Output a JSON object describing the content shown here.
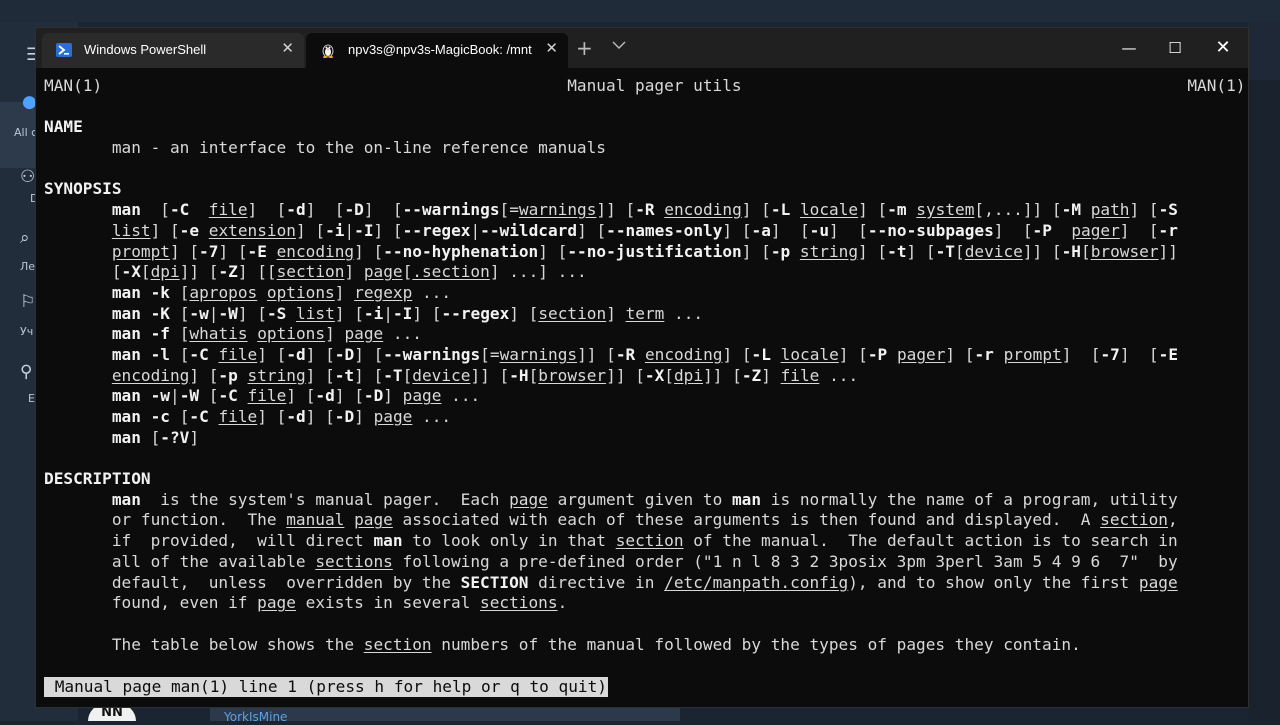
{
  "background_app": {
    "rail_labels": [
      "All c",
      "D",
      "Ле",
      "Уч",
      "E"
    ],
    "bottom_logo_text": "NN",
    "bottom_link": "YorkIsMine"
  },
  "window": {
    "tabs": [
      {
        "title": "Windows PowerShell",
        "icon": "powershell-icon",
        "active": false
      },
      {
        "title": "npv3s@npv3s-MagicBook: /mnt",
        "icon": "linux-tux-icon",
        "active": true
      }
    ],
    "new_tab_glyph": "+",
    "dropdown_glyph": "⌄",
    "controls": {
      "minimize": "—",
      "maximize": "☐",
      "close": "✕"
    }
  },
  "terminal": {
    "lines": [
      [
        {
          "t": "MAN(1)                                                Manual pager utils                                              MAN(1)"
        }
      ],
      [
        {
          "t": ""
        }
      ],
      [
        {
          "t": "NAME",
          "s": "b"
        }
      ],
      [
        {
          "t": "       man - an interface to the on-line reference manuals"
        }
      ],
      [
        {
          "t": ""
        }
      ],
      [
        {
          "t": "SYNOPSIS",
          "s": "b"
        }
      ],
      [
        {
          "t": "       "
        },
        {
          "t": "man",
          "s": "b"
        },
        {
          "t": "  ["
        },
        {
          "t": "-C",
          "s": "b"
        },
        {
          "t": "  "
        },
        {
          "t": "file",
          "s": "u"
        },
        {
          "t": "]  ["
        },
        {
          "t": "-d",
          "s": "b"
        },
        {
          "t": "]  ["
        },
        {
          "t": "-D",
          "s": "b"
        },
        {
          "t": "]  ["
        },
        {
          "t": "--warnings",
          "s": "b"
        },
        {
          "t": "[="
        },
        {
          "t": "warnings",
          "s": "u"
        },
        {
          "t": "]] ["
        },
        {
          "t": "-R",
          "s": "b"
        },
        {
          "t": " "
        },
        {
          "t": "encoding",
          "s": "u"
        },
        {
          "t": "] ["
        },
        {
          "t": "-L",
          "s": "b"
        },
        {
          "t": " "
        },
        {
          "t": "locale",
          "s": "u"
        },
        {
          "t": "] ["
        },
        {
          "t": "-m",
          "s": "b"
        },
        {
          "t": " "
        },
        {
          "t": "system",
          "s": "u"
        },
        {
          "t": "[,...]] ["
        },
        {
          "t": "-M",
          "s": "b"
        },
        {
          "t": " "
        },
        {
          "t": "path",
          "s": "u"
        },
        {
          "t": "] ["
        },
        {
          "t": "-S",
          "s": "b"
        }
      ],
      [
        {
          "t": "       "
        },
        {
          "t": "list",
          "s": "u"
        },
        {
          "t": "] ["
        },
        {
          "t": "-e",
          "s": "b"
        },
        {
          "t": " "
        },
        {
          "t": "extension",
          "s": "u"
        },
        {
          "t": "] ["
        },
        {
          "t": "-i",
          "s": "b"
        },
        {
          "t": "|"
        },
        {
          "t": "-I",
          "s": "b"
        },
        {
          "t": "] ["
        },
        {
          "t": "--regex",
          "s": "b"
        },
        {
          "t": "|"
        },
        {
          "t": "--wildcard",
          "s": "b"
        },
        {
          "t": "] ["
        },
        {
          "t": "--names-only",
          "s": "b"
        },
        {
          "t": "] ["
        },
        {
          "t": "-a",
          "s": "b"
        },
        {
          "t": "]  ["
        },
        {
          "t": "-u",
          "s": "b"
        },
        {
          "t": "]  ["
        },
        {
          "t": "--no-subpages",
          "s": "b"
        },
        {
          "t": "]  ["
        },
        {
          "t": "-P",
          "s": "b"
        },
        {
          "t": "  "
        },
        {
          "t": "pager",
          "s": "u"
        },
        {
          "t": "]  ["
        },
        {
          "t": "-r",
          "s": "b"
        }
      ],
      [
        {
          "t": "       "
        },
        {
          "t": "prompt",
          "s": "u"
        },
        {
          "t": "] ["
        },
        {
          "t": "-7",
          "s": "b"
        },
        {
          "t": "] ["
        },
        {
          "t": "-E",
          "s": "b"
        },
        {
          "t": " "
        },
        {
          "t": "encoding",
          "s": "u"
        },
        {
          "t": "] ["
        },
        {
          "t": "--no-hyphenation",
          "s": "b"
        },
        {
          "t": "] ["
        },
        {
          "t": "--no-justification",
          "s": "b"
        },
        {
          "t": "] ["
        },
        {
          "t": "-p",
          "s": "b"
        },
        {
          "t": " "
        },
        {
          "t": "string",
          "s": "u"
        },
        {
          "t": "] ["
        },
        {
          "t": "-t",
          "s": "b"
        },
        {
          "t": "] ["
        },
        {
          "t": "-T",
          "s": "b"
        },
        {
          "t": "["
        },
        {
          "t": "device",
          "s": "u"
        },
        {
          "t": "]] ["
        },
        {
          "t": "-H",
          "s": "b"
        },
        {
          "t": "["
        },
        {
          "t": "browser",
          "s": "u"
        },
        {
          "t": "]]"
        }
      ],
      [
        {
          "t": "       ["
        },
        {
          "t": "-X",
          "s": "b"
        },
        {
          "t": "["
        },
        {
          "t": "dpi",
          "s": "u"
        },
        {
          "t": "]] ["
        },
        {
          "t": "-Z",
          "s": "b"
        },
        {
          "t": "] [["
        },
        {
          "t": "section",
          "s": "u"
        },
        {
          "t": "] "
        },
        {
          "t": "page",
          "s": "u"
        },
        {
          "t": "["
        },
        {
          "t": ".section",
          "s": "u"
        },
        {
          "t": "] ...] ..."
        }
      ],
      [
        {
          "t": "       "
        },
        {
          "t": "man",
          "s": "b"
        },
        {
          "t": " "
        },
        {
          "t": "-k",
          "s": "b"
        },
        {
          "t": " ["
        },
        {
          "t": "apropos",
          "s": "u"
        },
        {
          "t": " "
        },
        {
          "t": "options",
          "s": "u"
        },
        {
          "t": "] "
        },
        {
          "t": "regexp",
          "s": "u"
        },
        {
          "t": " ..."
        }
      ],
      [
        {
          "t": "       "
        },
        {
          "t": "man",
          "s": "b"
        },
        {
          "t": " "
        },
        {
          "t": "-K",
          "s": "b"
        },
        {
          "t": " ["
        },
        {
          "t": "-w",
          "s": "b"
        },
        {
          "t": "|"
        },
        {
          "t": "-W",
          "s": "b"
        },
        {
          "t": "] ["
        },
        {
          "t": "-S",
          "s": "b"
        },
        {
          "t": " "
        },
        {
          "t": "list",
          "s": "u"
        },
        {
          "t": "] ["
        },
        {
          "t": "-i",
          "s": "b"
        },
        {
          "t": "|"
        },
        {
          "t": "-I",
          "s": "b"
        },
        {
          "t": "] ["
        },
        {
          "t": "--regex",
          "s": "b"
        },
        {
          "t": "] ["
        },
        {
          "t": "section",
          "s": "u"
        },
        {
          "t": "] "
        },
        {
          "t": "term",
          "s": "u"
        },
        {
          "t": " ..."
        }
      ],
      [
        {
          "t": "       "
        },
        {
          "t": "man",
          "s": "b"
        },
        {
          "t": " "
        },
        {
          "t": "-f",
          "s": "b"
        },
        {
          "t": " ["
        },
        {
          "t": "whatis",
          "s": "u"
        },
        {
          "t": " "
        },
        {
          "t": "options",
          "s": "u"
        },
        {
          "t": "] "
        },
        {
          "t": "page",
          "s": "u"
        },
        {
          "t": " ..."
        }
      ],
      [
        {
          "t": "       "
        },
        {
          "t": "man",
          "s": "b"
        },
        {
          "t": " "
        },
        {
          "t": "-l",
          "s": "b"
        },
        {
          "t": " ["
        },
        {
          "t": "-C",
          "s": "b"
        },
        {
          "t": " "
        },
        {
          "t": "file",
          "s": "u"
        },
        {
          "t": "] ["
        },
        {
          "t": "-d",
          "s": "b"
        },
        {
          "t": "] ["
        },
        {
          "t": "-D",
          "s": "b"
        },
        {
          "t": "] ["
        },
        {
          "t": "--warnings",
          "s": "b"
        },
        {
          "t": "[="
        },
        {
          "t": "warnings",
          "s": "u"
        },
        {
          "t": "]] ["
        },
        {
          "t": "-R",
          "s": "b"
        },
        {
          "t": " "
        },
        {
          "t": "encoding",
          "s": "u"
        },
        {
          "t": "] ["
        },
        {
          "t": "-L",
          "s": "b"
        },
        {
          "t": " "
        },
        {
          "t": "locale",
          "s": "u"
        },
        {
          "t": "] ["
        },
        {
          "t": "-P",
          "s": "b"
        },
        {
          "t": " "
        },
        {
          "t": "pager",
          "s": "u"
        },
        {
          "t": "] ["
        },
        {
          "t": "-r",
          "s": "b"
        },
        {
          "t": " "
        },
        {
          "t": "prompt",
          "s": "u"
        },
        {
          "t": "]  ["
        },
        {
          "t": "-7",
          "s": "b"
        },
        {
          "t": "]  ["
        },
        {
          "t": "-E",
          "s": "b"
        }
      ],
      [
        {
          "t": "       "
        },
        {
          "t": "encoding",
          "s": "u"
        },
        {
          "t": "] ["
        },
        {
          "t": "-p",
          "s": "b"
        },
        {
          "t": " "
        },
        {
          "t": "string",
          "s": "u"
        },
        {
          "t": "] ["
        },
        {
          "t": "-t",
          "s": "b"
        },
        {
          "t": "] ["
        },
        {
          "t": "-T",
          "s": "b"
        },
        {
          "t": "["
        },
        {
          "t": "device",
          "s": "u"
        },
        {
          "t": "]] ["
        },
        {
          "t": "-H",
          "s": "b"
        },
        {
          "t": "["
        },
        {
          "t": "browser",
          "s": "u"
        },
        {
          "t": "]] ["
        },
        {
          "t": "-X",
          "s": "b"
        },
        {
          "t": "["
        },
        {
          "t": "dpi",
          "s": "u"
        },
        {
          "t": "]] ["
        },
        {
          "t": "-Z",
          "s": "b"
        },
        {
          "t": "] "
        },
        {
          "t": "file",
          "s": "u"
        },
        {
          "t": " ..."
        }
      ],
      [
        {
          "t": "       "
        },
        {
          "t": "man",
          "s": "b"
        },
        {
          "t": " "
        },
        {
          "t": "-w",
          "s": "b"
        },
        {
          "t": "|"
        },
        {
          "t": "-W",
          "s": "b"
        },
        {
          "t": " ["
        },
        {
          "t": "-C",
          "s": "b"
        },
        {
          "t": " "
        },
        {
          "t": "file",
          "s": "u"
        },
        {
          "t": "] ["
        },
        {
          "t": "-d",
          "s": "b"
        },
        {
          "t": "] ["
        },
        {
          "t": "-D",
          "s": "b"
        },
        {
          "t": "] "
        },
        {
          "t": "page",
          "s": "u"
        },
        {
          "t": " ..."
        }
      ],
      [
        {
          "t": "       "
        },
        {
          "t": "man",
          "s": "b"
        },
        {
          "t": " "
        },
        {
          "t": "-c",
          "s": "b"
        },
        {
          "t": " ["
        },
        {
          "t": "-C",
          "s": "b"
        },
        {
          "t": " "
        },
        {
          "t": "file",
          "s": "u"
        },
        {
          "t": "] ["
        },
        {
          "t": "-d",
          "s": "b"
        },
        {
          "t": "] ["
        },
        {
          "t": "-D",
          "s": "b"
        },
        {
          "t": "] "
        },
        {
          "t": "page",
          "s": "u"
        },
        {
          "t": " ..."
        }
      ],
      [
        {
          "t": "       "
        },
        {
          "t": "man",
          "s": "b"
        },
        {
          "t": " ["
        },
        {
          "t": "-?V",
          "s": "b"
        },
        {
          "t": "]"
        }
      ],
      [
        {
          "t": ""
        }
      ],
      [
        {
          "t": "DESCRIPTION",
          "s": "b"
        }
      ],
      [
        {
          "t": "       "
        },
        {
          "t": "man",
          "s": "b"
        },
        {
          "t": "  is the system's manual pager.  Each "
        },
        {
          "t": "page",
          "s": "u"
        },
        {
          "t": " argument given to "
        },
        {
          "t": "man",
          "s": "b"
        },
        {
          "t": " is normally the name of a program, utility"
        }
      ],
      [
        {
          "t": "       or function.  The "
        },
        {
          "t": "manual",
          "s": "u"
        },
        {
          "t": " "
        },
        {
          "t": "page",
          "s": "u"
        },
        {
          "t": " associated with each of these arguments is then found and displayed.  A "
        },
        {
          "t": "section",
          "s": "u"
        },
        {
          "t": ","
        }
      ],
      [
        {
          "t": "       if  provided,  will direct "
        },
        {
          "t": "man",
          "s": "b"
        },
        {
          "t": " to look only in that "
        },
        {
          "t": "section",
          "s": "u"
        },
        {
          "t": " of the manual.  The default action is to search in"
        }
      ],
      [
        {
          "t": "       all of the available "
        },
        {
          "t": "sections",
          "s": "u"
        },
        {
          "t": " following a pre-defined order (\"1 n l 8 3 2 3posix 3pm 3perl 3am 5 4 9 6  7\"  by"
        }
      ],
      [
        {
          "t": "       default,  unless  overridden by the "
        },
        {
          "t": "SECTION",
          "s": "b"
        },
        {
          "t": " directive in "
        },
        {
          "t": "/etc/manpath.config",
          "s": "u"
        },
        {
          "t": "), and to show only the first "
        },
        {
          "t": "page",
          "s": "u"
        }
      ],
      [
        {
          "t": "       found, even if "
        },
        {
          "t": "page",
          "s": "u"
        },
        {
          "t": " exists in several "
        },
        {
          "t": "sections",
          "s": "u"
        },
        {
          "t": "."
        }
      ],
      [
        {
          "t": ""
        }
      ],
      [
        {
          "t": "       The table below shows the "
        },
        {
          "t": "section",
          "s": "u"
        },
        {
          "t": " numbers of the manual followed by the types of pages they contain."
        }
      ]
    ],
    "status_line": " Manual page man(1) line 1 (press h for help or q to quit)"
  }
}
